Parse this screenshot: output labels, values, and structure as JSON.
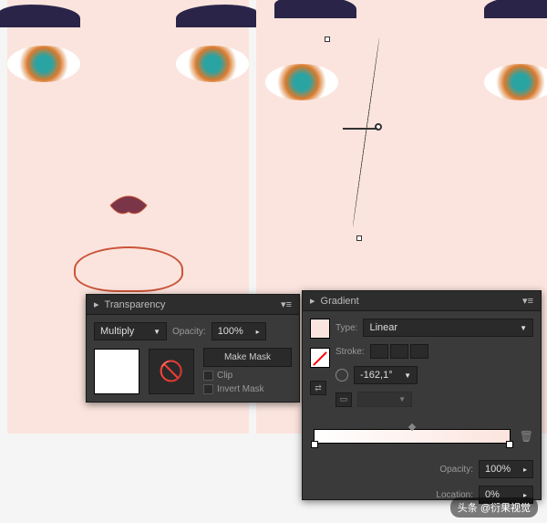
{
  "watermark_top": "头条@衍果视觉",
  "watermark_bottom": "头条 @衍果视觉",
  "transparency": {
    "title": "Transparency",
    "blend_mode": "Multiply",
    "opacity_label": "Opacity:",
    "opacity_value": "100%",
    "make_mask": "Make Mask",
    "clip": "Clip",
    "invert_mask": "Invert Mask"
  },
  "gradient": {
    "title": "Gradient",
    "type_label": "Type:",
    "type_value": "Linear",
    "stroke_label": "Stroke:",
    "angle_value": "-162,1°",
    "opacity_label": "Opacity:",
    "opacity_value": "100%",
    "location_label": "Location:",
    "location_value": "0%"
  }
}
